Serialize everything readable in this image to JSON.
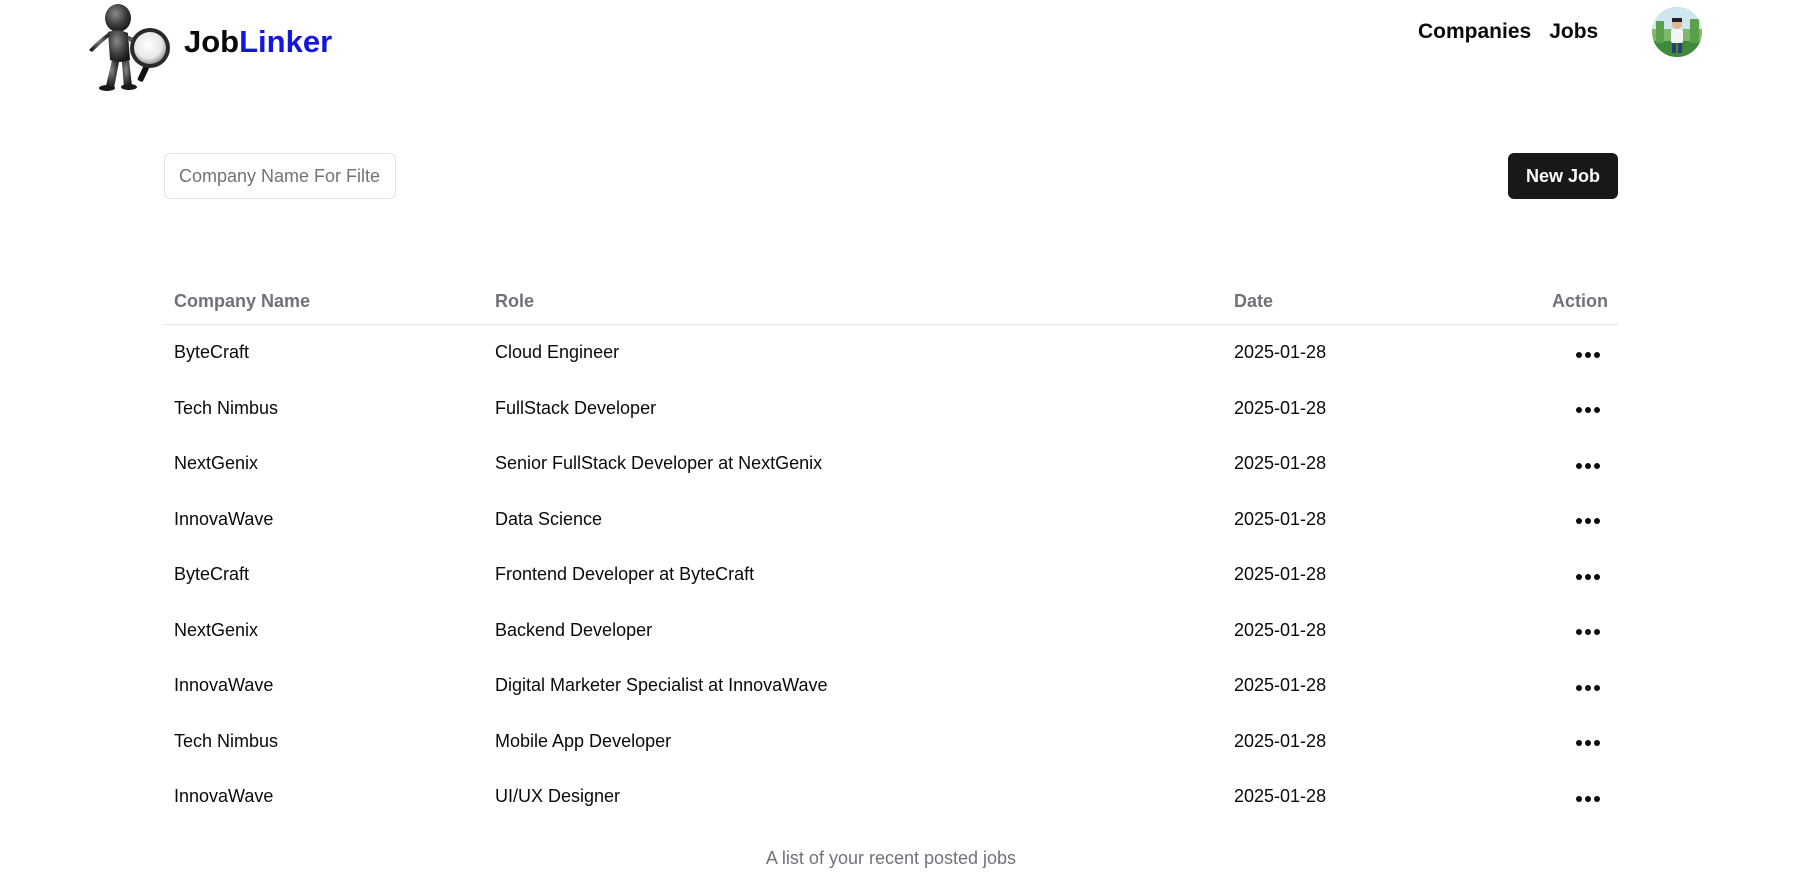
{
  "brand": {
    "part1": "Job",
    "part2": "Linker",
    "color_part2": "#1515e0"
  },
  "nav": {
    "items": [
      "Companies",
      "Jobs"
    ]
  },
  "user": {
    "avatar_icon": "user-avatar"
  },
  "toolbar": {
    "filter_placeholder": "Company Name For Filter",
    "filter_value": "",
    "new_job_label": "New Job"
  },
  "table": {
    "headers": {
      "company": "Company Name",
      "role": "Role",
      "date": "Date",
      "action": "Action"
    },
    "rows": [
      {
        "company": "ByteCraft",
        "role": "Cloud Engineer",
        "date": "2025-01-28"
      },
      {
        "company": "Tech Nimbus",
        "role": "FullStack Developer",
        "date": "2025-01-28"
      },
      {
        "company": "NextGenix",
        "role": "Senior FullStack Developer at NextGenix",
        "date": "2025-01-28"
      },
      {
        "company": "InnovaWave",
        "role": "Data Science",
        "date": "2025-01-28"
      },
      {
        "company": "ByteCraft",
        "role": "Frontend Developer at ByteCraft",
        "date": "2025-01-28"
      },
      {
        "company": "NextGenix",
        "role": "Backend Developer",
        "date": "2025-01-28"
      },
      {
        "company": "InnovaWave",
        "role": "Digital Marketer Specialist at InnovaWave",
        "date": "2025-01-28"
      },
      {
        "company": "Tech Nimbus",
        "role": "Mobile App Developer",
        "date": "2025-01-28"
      },
      {
        "company": "InnovaWave",
        "role": "UI/UX Designer",
        "date": "2025-01-28"
      }
    ],
    "caption": "A list of your recent posted jobs"
  },
  "colors": {
    "button_bg": "#18181b",
    "muted_text": "#71717a",
    "border": "#e4e4e7"
  }
}
